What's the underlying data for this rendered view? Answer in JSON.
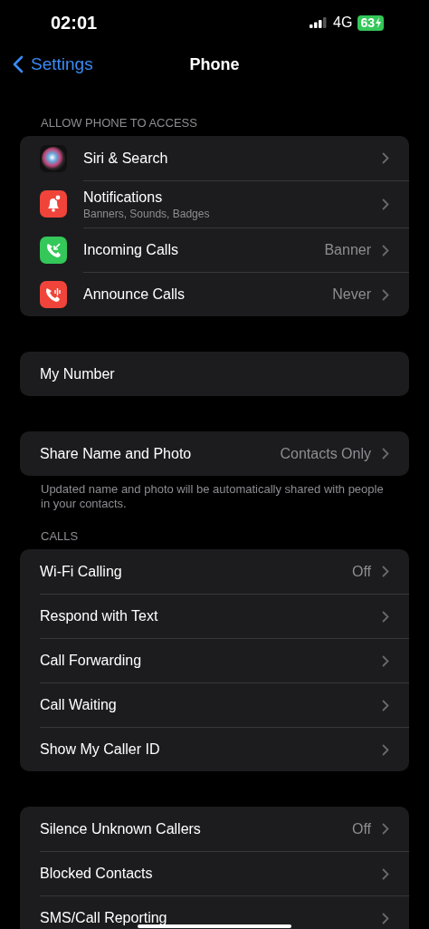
{
  "status_bar": {
    "time": "02:01",
    "network": "4G",
    "battery": "63"
  },
  "nav": {
    "back": "Settings",
    "title": "Phone"
  },
  "sections": [
    {
      "header": "ALLOW PHONE TO ACCESS",
      "rows": [
        {
          "label": "Siri & Search",
          "chevron": true
        },
        {
          "label": "Notifications",
          "subtitle": "Banners, Sounds, Badges",
          "chevron": true
        },
        {
          "label": "Incoming Calls",
          "value": "Banner",
          "chevron": true
        },
        {
          "label": "Announce Calls",
          "value": "Never",
          "chevron": true
        }
      ]
    },
    {
      "rows": [
        {
          "label": "My Number",
          "chevron": false
        }
      ]
    },
    {
      "rows": [
        {
          "label": "Share Name and Photo",
          "value": "Contacts Only",
          "chevron": true
        }
      ],
      "footer": "Updated name and photo will be automatically shared with people in your contacts."
    },
    {
      "header": "CALLS",
      "rows": [
        {
          "label": "Wi-Fi Calling",
          "value": "Off",
          "chevron": true
        },
        {
          "label": "Respond with Text",
          "chevron": true
        },
        {
          "label": "Call Forwarding",
          "chevron": true
        },
        {
          "label": "Call Waiting",
          "chevron": true
        },
        {
          "label": "Show My Caller ID",
          "chevron": true
        }
      ]
    },
    {
      "rows": [
        {
          "label": "Silence Unknown Callers",
          "value": "Off",
          "chevron": true
        },
        {
          "label": "Blocked Contacts",
          "chevron": true
        },
        {
          "label": "SMS/Call Reporting",
          "chevron": true
        }
      ]
    }
  ]
}
